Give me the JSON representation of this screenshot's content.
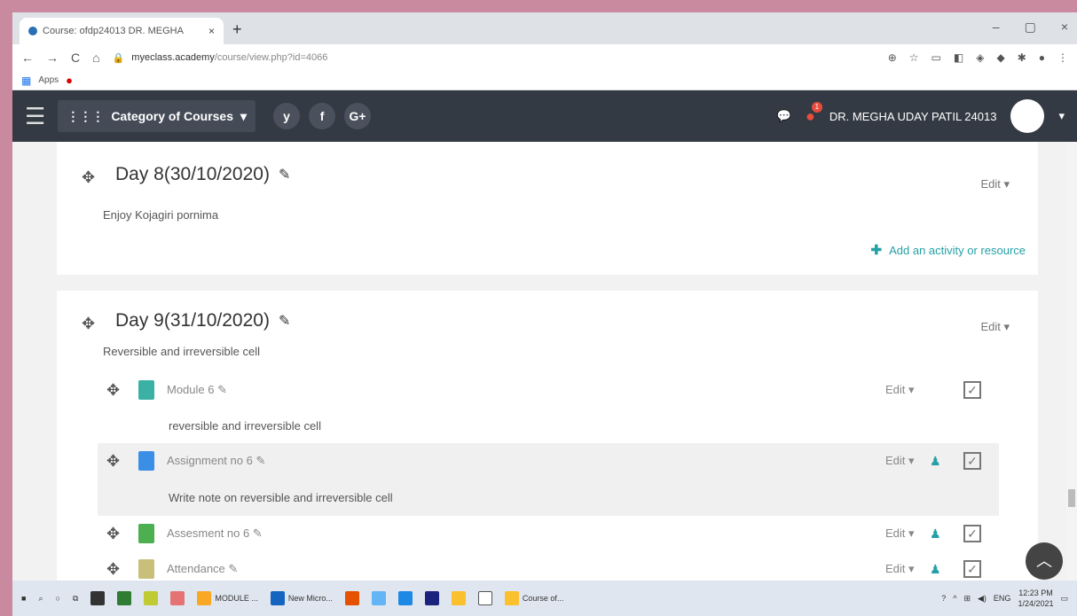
{
  "browser": {
    "tab_title": "Course: ofdp24013 DR. MEGHA",
    "tab_close": "×",
    "new_tab": "+",
    "win_min": "–",
    "win_max": "▢",
    "win_close": "×",
    "url_host": "myeclass.academy",
    "url_path": "/course/view.php?id=4066",
    "apps_label": "Apps"
  },
  "navbar": {
    "category_label": "Category of Courses",
    "social": [
      "y",
      "f",
      "G+"
    ],
    "user_name": "DR. MEGHA UDAY PATIL 24013",
    "notif_count": "1"
  },
  "sections": [
    {
      "title": "Day 8(30/10/2020)",
      "edit": "Edit",
      "summary": "Enjoy Kojagiri pornima",
      "add_activity": "Add an activity or resource"
    },
    {
      "title": "Day 9(31/10/2020)",
      "edit": "Edit",
      "summary": "Reversible and irreversible cell"
    }
  ],
  "activities": [
    {
      "name": "Module 6",
      "edit": "Edit",
      "desc": "reversible and irreversible cell",
      "icon_color": "#3bb1a6"
    },
    {
      "name": "Assignment no 6",
      "edit": "Edit",
      "desc": "Write note on reversible and irreversible cell",
      "icon_color": "#3a8ee6"
    },
    {
      "name": "Assesment no 6",
      "edit": "Edit",
      "icon_color": "#4caf50"
    },
    {
      "name": "Attendance",
      "edit": "Edit",
      "icon_color": "#c8c07a"
    }
  ],
  "taskbar": {
    "items": [
      "MODULE ...",
      "New Micro...",
      "Course of..."
    ],
    "lang": "ENG",
    "time": "12:23 PM",
    "date": "1/24/2021"
  }
}
